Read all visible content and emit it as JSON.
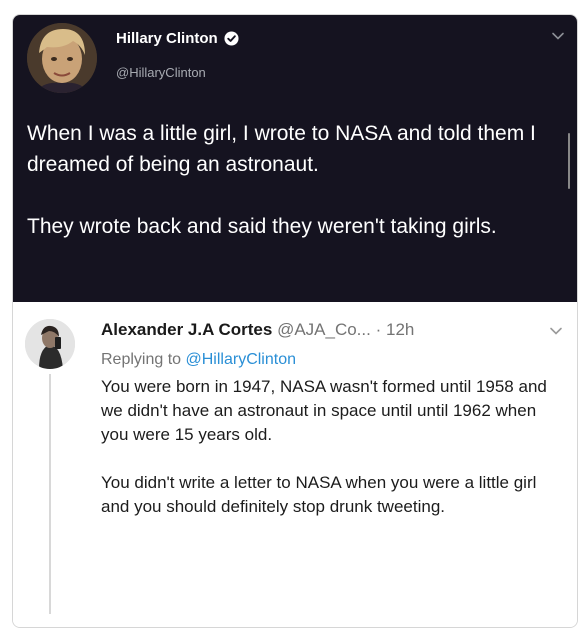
{
  "original_tweet": {
    "author_name": "Hillary Clinton",
    "author_handle": "@HillaryClinton",
    "verified": true,
    "paragraphs": [
      "When I was a little girl, I wrote to NASA and told them I dreamed of being an astronaut.",
      "They wrote back and said they weren't taking girls."
    ]
  },
  "reply_tweet": {
    "author_name": "Alexander J.A Cortes",
    "author_handle": "@AJA_Co...",
    "separator": "·",
    "time": "12h",
    "replying_prefix": "Replying to",
    "replying_mention": "@HillaryClinton",
    "paragraphs": [
      "You were born in 1947, NASA wasn't formed until 1958 and we didn't have an astronaut in space until until 1962 when you were 15 years old.",
      "You didn't write a letter to NASA when you were a little girl and you should definitely stop drunk tweeting."
    ]
  },
  "colors": {
    "dark_background": "#151320",
    "mention_blue": "#2a8fd6",
    "muted_gray": "#747474"
  },
  "icons": [
    "verified-badge-icon",
    "chevron-down-icon",
    "avatar"
  ]
}
